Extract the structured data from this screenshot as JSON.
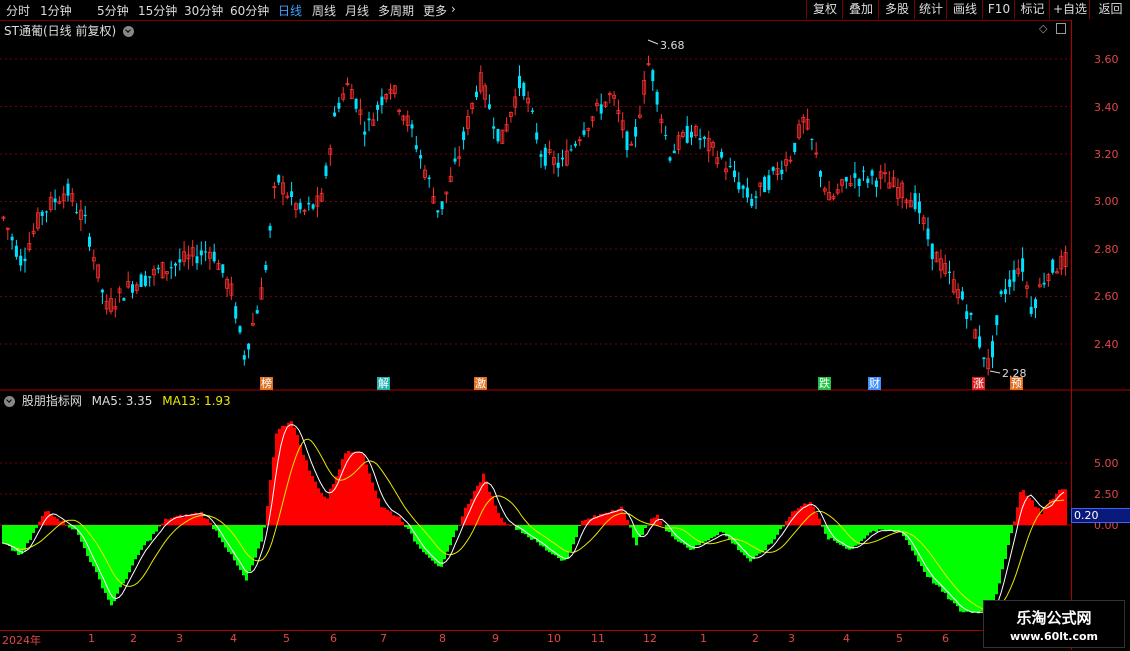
{
  "toolbar": {
    "periods": [
      "分时",
      "1分钟",
      "5分钟",
      "15分钟",
      "30分钟",
      "60分钟",
      "日线",
      "周线",
      "月线",
      "多周期",
      "更多"
    ],
    "active_period": "日线",
    "right_buttons": [
      "复权",
      "叠加",
      "多股",
      "统计",
      "画线",
      "F10",
      "标记",
      "+自选",
      "返回"
    ]
  },
  "main_chart": {
    "title": "ST通葡(日线 前复权)",
    "price_labels": [
      "3.60",
      "3.40",
      "3.20",
      "3.00",
      "2.80",
      "2.60",
      "2.40"
    ],
    "high_label": "3.68",
    "low_label": "2.28",
    "events": [
      {
        "text": "榜",
        "color": "#e07020"
      },
      {
        "text": "解",
        "color": "#20b0b0"
      },
      {
        "text": "激",
        "color": "#e07020"
      },
      {
        "text": "跌",
        "color": "#20c040"
      },
      {
        "text": "财",
        "color": "#4090ff"
      },
      {
        "text": "涨",
        "color": "#e02020"
      },
      {
        "text": "预",
        "color": "#e07020"
      }
    ]
  },
  "indicator": {
    "name": "股朋指标网",
    "ma5": "MA5: 3.35",
    "ma13": "MA13: 1.93",
    "axis_labels": [
      "5.00",
      "2.50",
      "0.00"
    ],
    "current_value": "0.20"
  },
  "date_axis": {
    "labels": [
      "2024年",
      "1",
      "2",
      "3",
      "4",
      "5",
      "6",
      "7",
      "8",
      "9",
      "10",
      "11",
      "12",
      "1",
      "2",
      "3",
      "4",
      "5",
      "6"
    ]
  },
  "watermark": {
    "line1": "乐淘公式网",
    "line2": "www.60lt.com"
  },
  "colors": {
    "up": "#ff3030",
    "down": "#00e0ff",
    "hist_pos": "#ff0000",
    "hist_neg": "#00ff00",
    "ma5_line": "#ffffff",
    "ma13_line": "#e8e800",
    "grid": "#7a0000"
  }
}
